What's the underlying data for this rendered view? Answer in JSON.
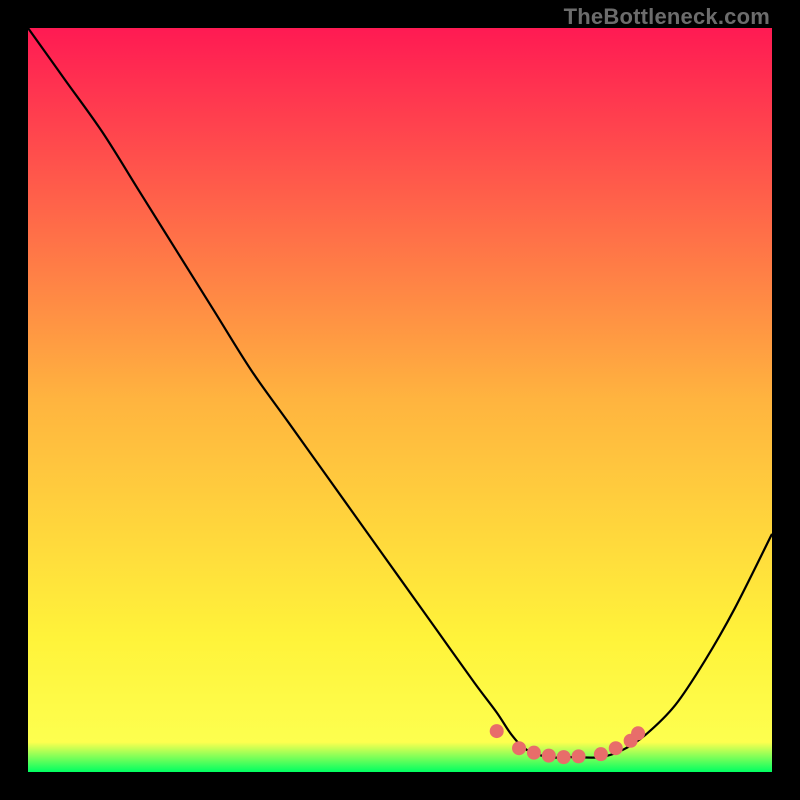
{
  "watermark": "TheBottleneck.com",
  "chart_data": {
    "type": "line",
    "title": "",
    "xlabel": "",
    "ylabel": "",
    "xlim": [
      0,
      100
    ],
    "ylim": [
      0,
      100
    ],
    "grid": false,
    "gradient": {
      "colors": [
        "#ff1a53",
        "#ffb43f",
        "#fff33a",
        "#fdff4f",
        "#00ff62"
      ],
      "stops": [
        0,
        0.5,
        0.82,
        0.96,
        1.0
      ]
    },
    "series": [
      {
        "name": "bottleneck-curve",
        "x": [
          0,
          5,
          10,
          15,
          20,
          25,
          30,
          35,
          40,
          45,
          50,
          55,
          60,
          63,
          65,
          67,
          70,
          73,
          77,
          80,
          83,
          87,
          91,
          95,
          100
        ],
        "values": [
          100,
          93,
          86,
          78,
          70,
          62,
          54,
          47,
          40,
          33,
          26,
          19,
          12,
          8,
          5,
          3,
          2,
          2,
          2,
          3,
          5,
          9,
          15,
          22,
          32
        ],
        "color": "#000000"
      }
    ],
    "markers": {
      "color": "#e86d6a",
      "radius": 7,
      "points": [
        {
          "x": 63,
          "y": 5.5
        },
        {
          "x": 66,
          "y": 3.2
        },
        {
          "x": 68,
          "y": 2.6
        },
        {
          "x": 70,
          "y": 2.2
        },
        {
          "x": 72,
          "y": 2.0
        },
        {
          "x": 74,
          "y": 2.1
        },
        {
          "x": 77,
          "y": 2.4
        },
        {
          "x": 79,
          "y": 3.2
        },
        {
          "x": 81,
          "y": 4.2
        },
        {
          "x": 82,
          "y": 5.2
        }
      ]
    }
  }
}
